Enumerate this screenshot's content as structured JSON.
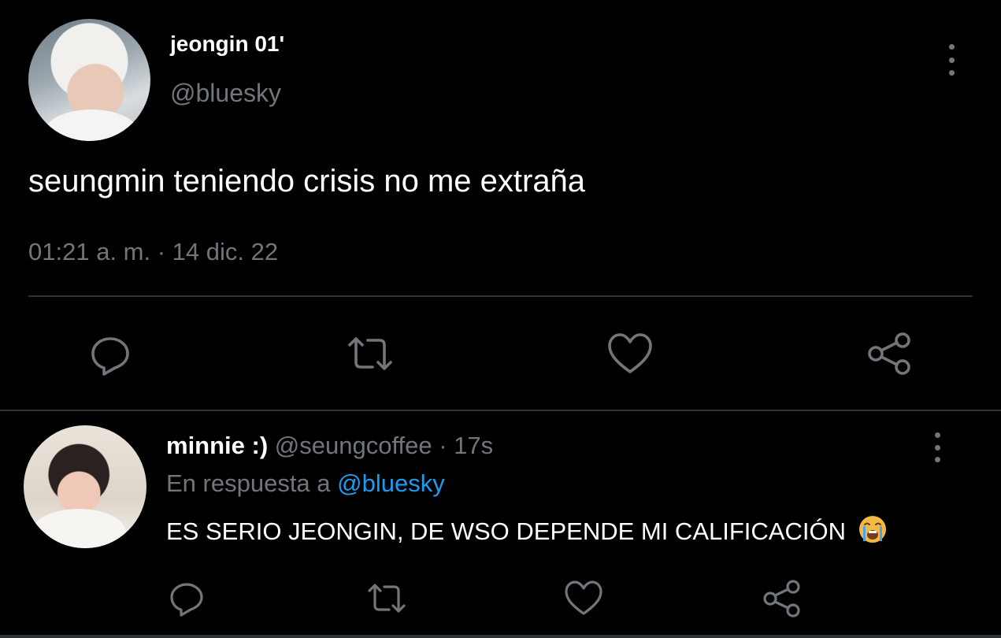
{
  "colors": {
    "background": "#000000",
    "primary_text": "#ffffff",
    "secondary_text": "#71767b",
    "accent": "#1d9bf0",
    "divider": "#2f3336"
  },
  "main_tweet": {
    "display_name": "jeongin 01'",
    "handle": "@bluesky",
    "text": "seungmin teniendo crisis no me extraña",
    "meta": "01:21 a. m. · 14 dic. 22",
    "actions": [
      "reply-icon",
      "retweet-icon",
      "like-icon",
      "share-icon"
    ]
  },
  "reply": {
    "display_name": "minnie :)",
    "handle_time": "@seungcoffee · 17s",
    "replying_prefix": "En respuesta a",
    "replying_to": "@bluesky",
    "text": "ES SERIO JEONGIN, DE WSO DEPENDE MI CALIFICACIÓN",
    "emoji": "loudly-crying-face",
    "actions": [
      "reply-icon",
      "retweet-icon",
      "like-icon",
      "share-icon"
    ]
  }
}
